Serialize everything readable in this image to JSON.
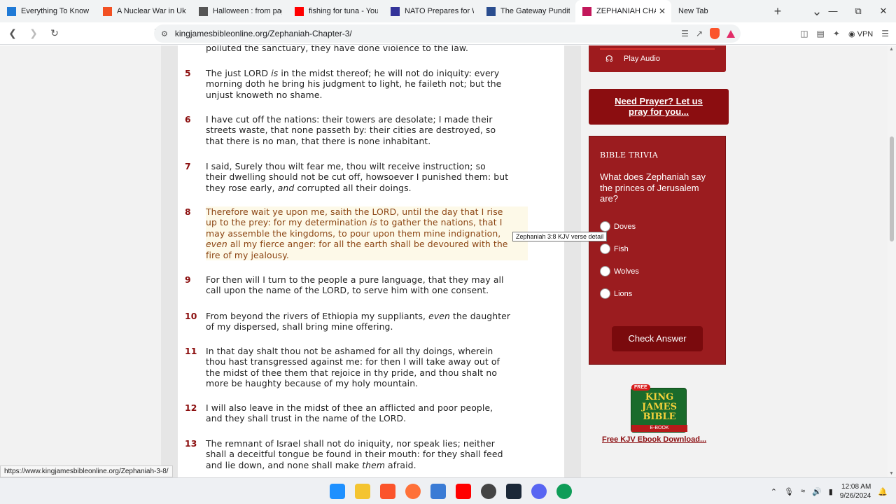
{
  "tabs": [
    {
      "title": "Everything To Know Ab",
      "fav_color": "#1f7ad6",
      "active": false
    },
    {
      "title": "A Nuclear War in Ukrai",
      "fav_color": "#f25022",
      "active": false
    },
    {
      "title": "Halloween : from paga",
      "fav_color": "#555555",
      "active": false
    },
    {
      "title": "fishing for tuna - YouT",
      "fav_color": "#ff0000",
      "active": false
    },
    {
      "title": "NATO Prepares for Wo",
      "fav_color": "#333399",
      "active": false
    },
    {
      "title": "The Gateway Pundit",
      "fav_color": "#2a4d8f",
      "active": false
    },
    {
      "title": "ZEPHANIAH CHAI",
      "fav_color": "#c2185b",
      "active": true
    },
    {
      "title": "New Tab",
      "fav_color": "",
      "active": false
    }
  ],
  "address": {
    "url": "kingjamesbibleonline.org/Zephaniah-Chapter-3/",
    "vpn_label": "VPN",
    "shield_count": "2"
  },
  "verses_top": "polluted the sanctuary, they have done violence to the law.",
  "verses": [
    {
      "num": "5",
      "highlight": false,
      "lines": [
        "The just LORD <i>is</i> in the midst thereof; he will not do iniquity: every",
        "morning doth he bring his judgment to light, he faileth not; but the",
        "unjust knoweth no shame."
      ]
    },
    {
      "num": "6",
      "highlight": false,
      "lines": [
        "I have cut off the nations: their towers are desolate; I made their",
        "streets waste, that none passeth by: their cities are destroyed, so",
        "that there is no man, that there is none inhabitant."
      ]
    },
    {
      "num": "7",
      "highlight": false,
      "lines": [
        "I said, Surely thou wilt fear me, thou wilt receive instruction; so",
        "their dwelling should not be cut off, howsoever I punished them: but",
        "they rose early, <i>and</i> corrupted all their doings."
      ]
    },
    {
      "num": "8",
      "highlight": true,
      "lines": [
        "Therefore wait ye upon me, saith the LORD, until the day that I rise",
        "up to the prey: for my determination <i>is</i> to gather the nations, that I",
        "may assemble the kingdoms, to pour upon them mine indignation,",
        "<i>even</i> all my fierce anger: for all the earth shall be devoured with the",
        "fire of my jealousy."
      ]
    },
    {
      "num": "9",
      "highlight": false,
      "lines": [
        "For then will I turn to the people a pure language, that they may all",
        "call upon the name of the LORD, to serve him with one consent."
      ]
    },
    {
      "num": "10",
      "highlight": false,
      "lines": [
        "From beyond the rivers of Ethiopia my suppliants, <i>even</i> the daughter",
        "of my dispersed, shall bring mine offering."
      ]
    },
    {
      "num": "11",
      "highlight": false,
      "lines": [
        "In that day shalt thou not be ashamed for all thy doings, wherein",
        "thou hast transgressed against me: for then I will take away out of",
        "the midst of thee them that rejoice in thy pride, and thou shalt no",
        "more be haughty because of my holy mountain."
      ]
    },
    {
      "num": "12",
      "highlight": false,
      "lines": [
        "I will also leave in the midst of thee an afflicted and poor people,",
        "and they shall trust in the name of the LORD."
      ]
    },
    {
      "num": "13",
      "highlight": false,
      "lines": [
        "The remnant of Israel shall not do iniquity, nor speak lies; neither",
        "shall a deceitful tongue be found in their mouth: for they shall feed",
        "and lie down, and none shall make <i>them</i> afraid."
      ]
    }
  ],
  "tooltip": "Zephaniah 3:8 KJV verse detail",
  "sidebar": {
    "play_audio": "Play Audio",
    "prayer_link": "Need Prayer? Let us pray for you...",
    "trivia_heading": "BIBLE TRIVIA",
    "trivia_question": "What does Zephaniah say the princes of Jerusalem are?",
    "options": [
      "Doves",
      "Fish",
      "Wolves",
      "Lions"
    ],
    "check_answer": "Check Answer",
    "ebook_badge": "FREE",
    "ebook_title_1": "KING",
    "ebook_title_2": "JAMES",
    "ebook_title_3": "BIBLE",
    "ebook_sub": "E-BOOK",
    "ebook_link": "Free KJV Ebook Download..."
  },
  "status_url": "https://www.kingjamesbibleonline.org/Zephaniah-3-8/",
  "clock": {
    "time": "12:08 AM",
    "date": "9/26/2024"
  },
  "colors": {
    "verse_num": "#8b0e0e",
    "sidebar_red": "#9b1c1f",
    "highlight_text": "#8b4513"
  }
}
